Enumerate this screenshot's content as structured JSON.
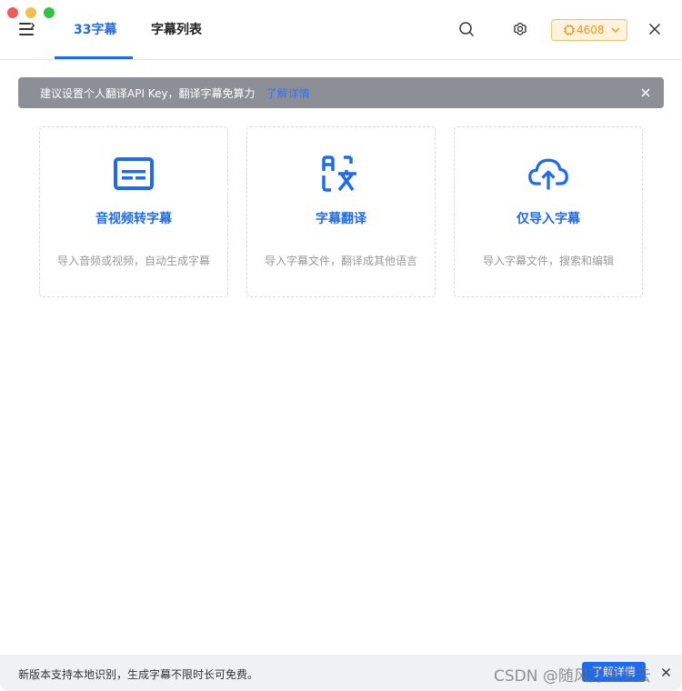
{
  "tabs": [
    {
      "label": "33字幕"
    },
    {
      "label": "字幕列表"
    }
  ],
  "credit": {
    "value": "4608"
  },
  "banner": {
    "text": "建议设置个人翻译API Key，翻译字幕免算力",
    "link": "了解详情"
  },
  "cards": [
    {
      "icon": "subtitle-icon",
      "title": "音视频转字幕",
      "desc": "导入音频或视频，自动生成字幕"
    },
    {
      "icon": "translate-icon",
      "title": "字幕翻译",
      "desc": "导入字幕文件，翻译成其他语言"
    },
    {
      "icon": "cloud-upload-icon",
      "title": "仅导入字幕",
      "desc": "导入字幕文件，搜索和编辑"
    }
  ],
  "bottom": {
    "message": "新版本支持本地识别，生成字幕不限时长可免费。",
    "button": "了解详情",
    "watermark": "CSDN @随风万里无云"
  },
  "colors": {
    "accent": "#1c6bf0",
    "banner_bg": "#8c8f95",
    "credit_text": "#e8961a",
    "credit_bg": "#fff3dd"
  }
}
